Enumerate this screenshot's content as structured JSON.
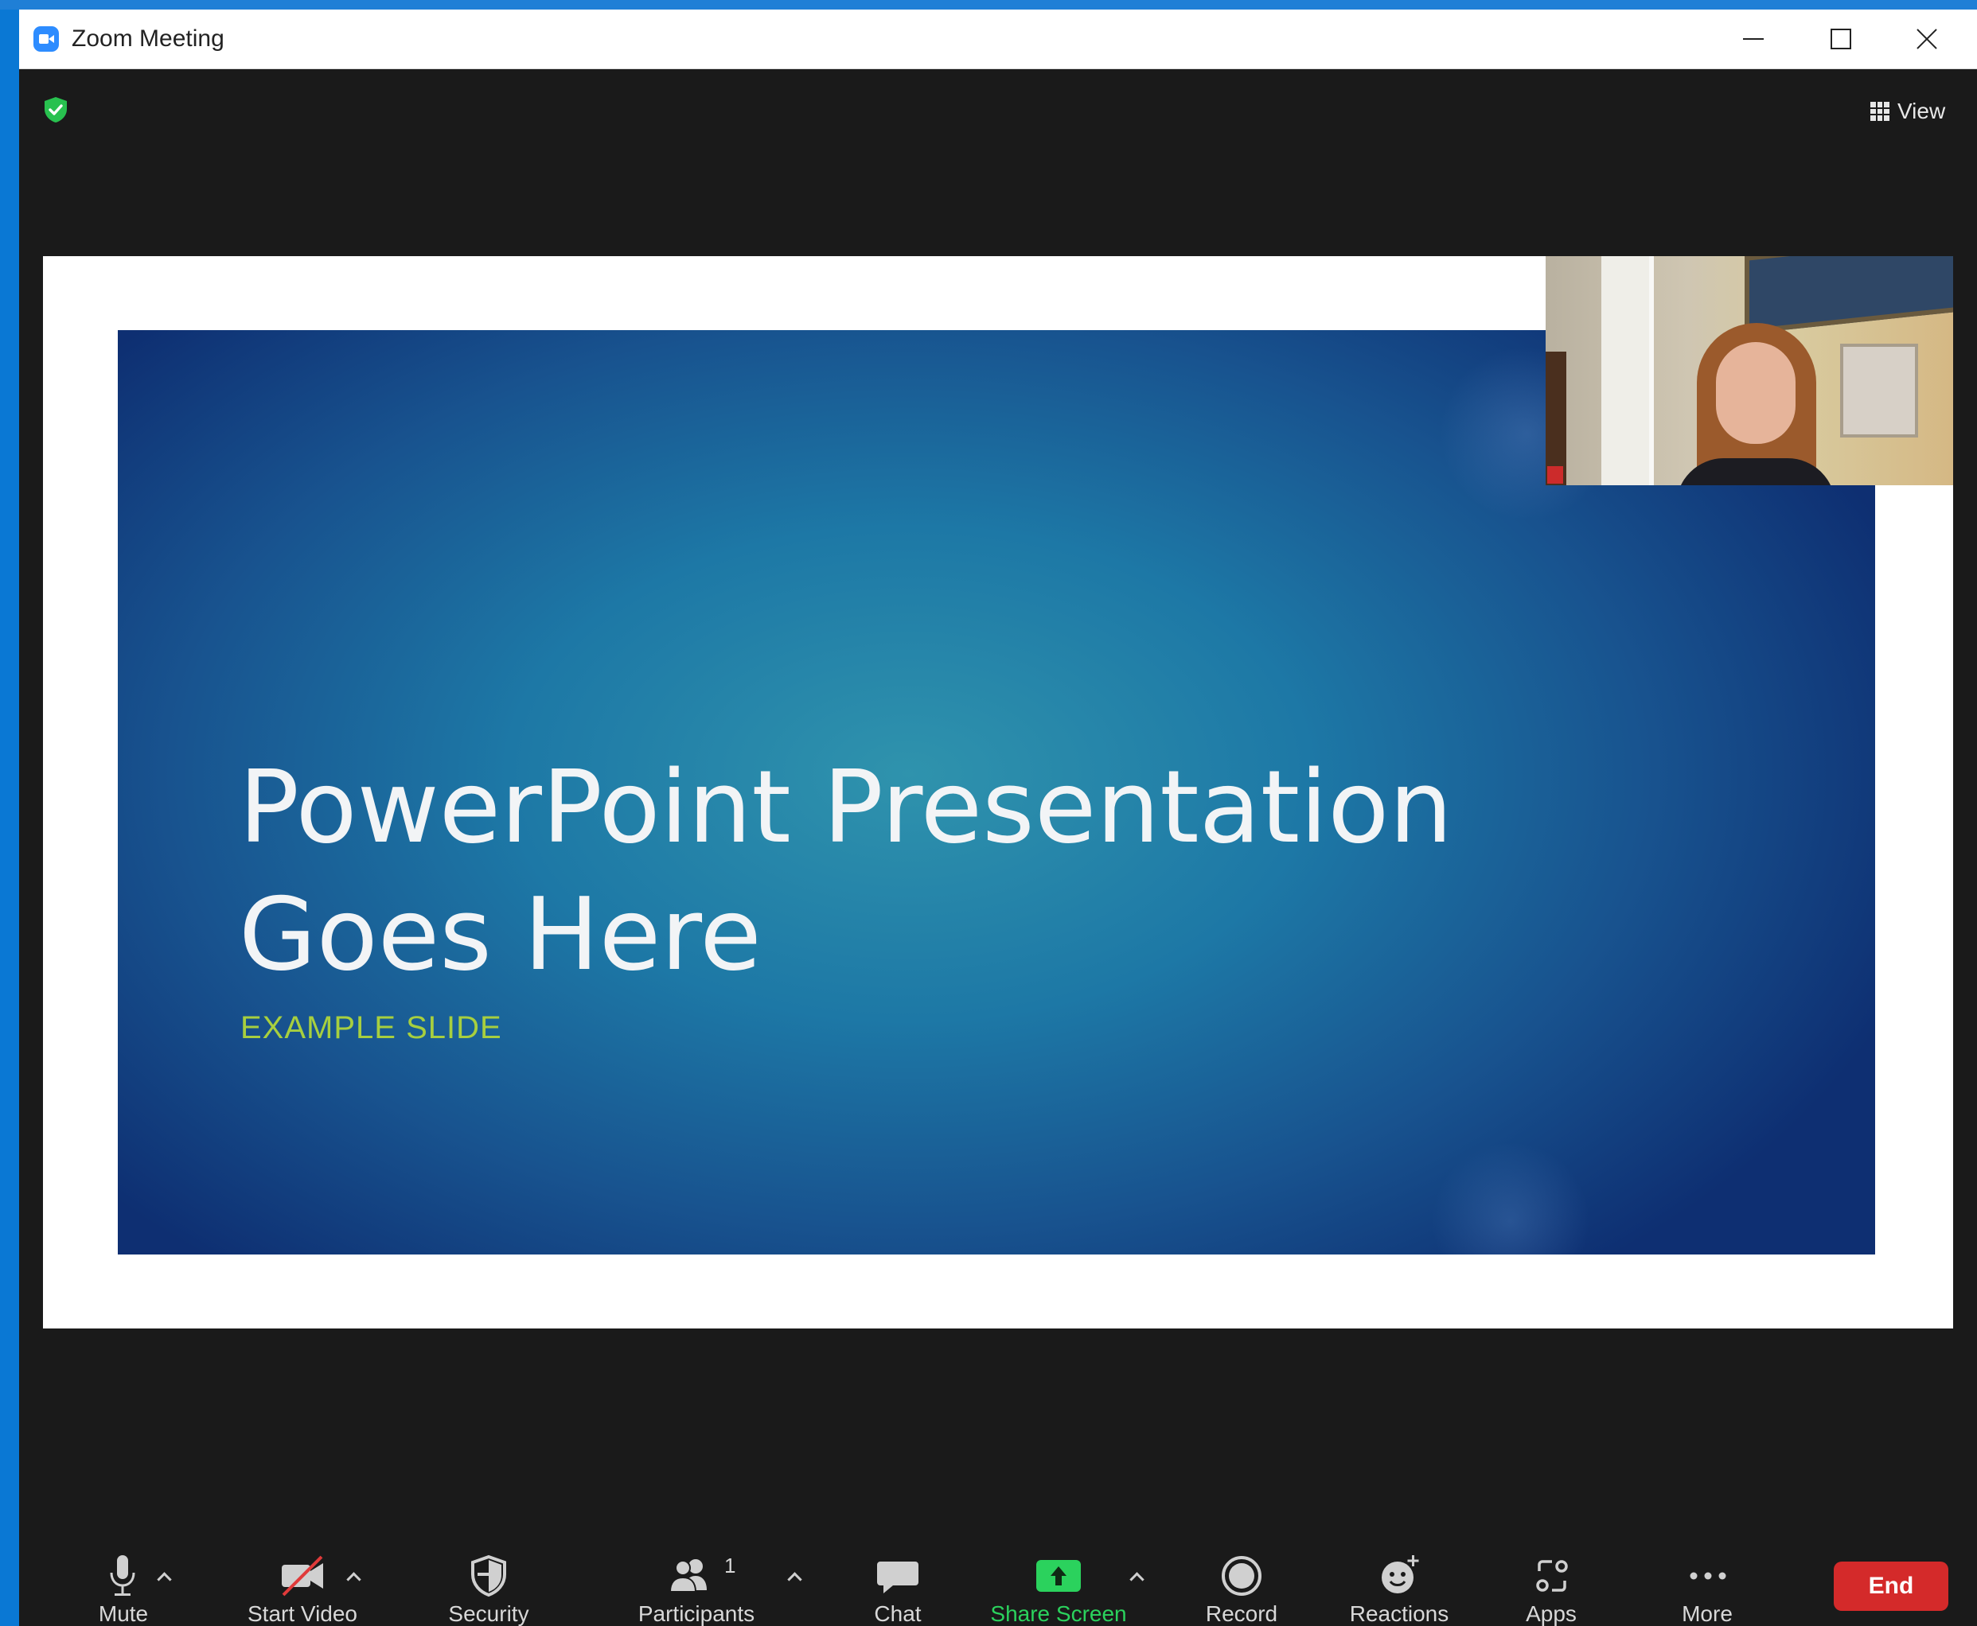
{
  "window": {
    "title": "Zoom Meeting"
  },
  "header": {
    "view_label": "View"
  },
  "slide": {
    "title_line1": "PowerPoint Presentation",
    "title_line2": "Goes Here",
    "subtitle": "EXAMPLE SLIDE"
  },
  "toolbar": {
    "mute_label": "Mute",
    "start_video_label": "Start Video",
    "security_label": "Security",
    "participants_label": "Participants",
    "participants_count": "1",
    "chat_label": "Chat",
    "share_screen_label": "Share Screen",
    "record_label": "Record",
    "reactions_label": "Reactions",
    "apps_label": "Apps",
    "more_label": "More",
    "end_label": "End"
  },
  "colors": {
    "accent": "#2d8cff",
    "share_green": "#2bd25d",
    "end_red": "#d42a2a",
    "subtitle_green": "#a7cf3f",
    "toolbar_bg": "#1a1a1a"
  },
  "icons": {
    "app": "zoom-camera-icon",
    "encryption": "shield-check-icon",
    "view": "grid-icon",
    "mute": "microphone-icon",
    "video": "video-off-icon",
    "security": "shield-icon",
    "participants": "people-icon",
    "chat": "speech-bubble-icon",
    "share": "share-arrow-icon",
    "record": "record-icon",
    "reactions": "smiley-plus-icon",
    "apps": "apps-icon",
    "more": "ellipsis-icon"
  }
}
